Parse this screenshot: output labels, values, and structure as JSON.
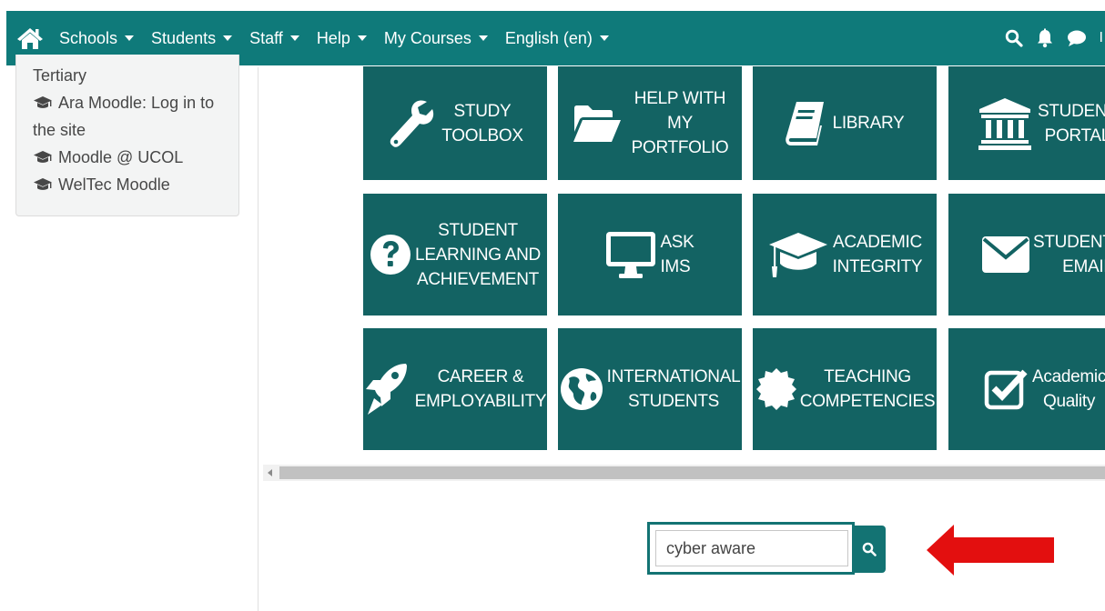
{
  "nav": {
    "items": [
      {
        "label": "Schools"
      },
      {
        "label": "Students"
      },
      {
        "label": "Staff"
      },
      {
        "label": "Help"
      },
      {
        "label": "My Courses"
      },
      {
        "label": "English (en)"
      }
    ],
    "truncated_user_text": "I"
  },
  "sidebar": {
    "items": [
      {
        "label": "Tertiary"
      },
      {
        "label": "Ara Moodle: Log in to the site"
      },
      {
        "label": "Moodle @ UCOL"
      },
      {
        "label": "WelTec Moodle"
      }
    ]
  },
  "tiles": [
    {
      "label": "STUDY\nTOOLBOX",
      "icon": "wrench-icon"
    },
    {
      "label": "HELP WITH\nMY\nPORTFOLIO",
      "icon": "folder-open-icon"
    },
    {
      "label": "LIBRARY",
      "icon": "book-icon"
    },
    {
      "label": "STUDENT\nPORTAL",
      "icon": "university-icon"
    },
    {
      "label": "STUDENT\nLEARNING AND\nACHIEVEMENT",
      "icon": "question-circle-icon"
    },
    {
      "label": "ASK\nIMS",
      "icon": "desktop-icon"
    },
    {
      "label": "ACADEMIC\nINTEGRITY",
      "icon": "graduation-cap-icon"
    },
    {
      "label": "STUDENT\nEMAIL",
      "icon": "envelope-icon"
    },
    {
      "label": "CAREER &\nEMPLOYABILITY",
      "icon": "rocket-icon"
    },
    {
      "label": "INTERNATIONAL\nSTUDENTS",
      "icon": "globe-icon"
    },
    {
      "label": "TEACHING\nCOMPETENCIES",
      "icon": "certificate-icon"
    },
    {
      "label": "Academic\nQuality",
      "icon": "check-square-icon"
    }
  ],
  "search": {
    "value": "cyber aware"
  },
  "colors": {
    "primary": "#0f7a7a",
    "tile": "#136363",
    "arrow": "#e30f0f"
  }
}
